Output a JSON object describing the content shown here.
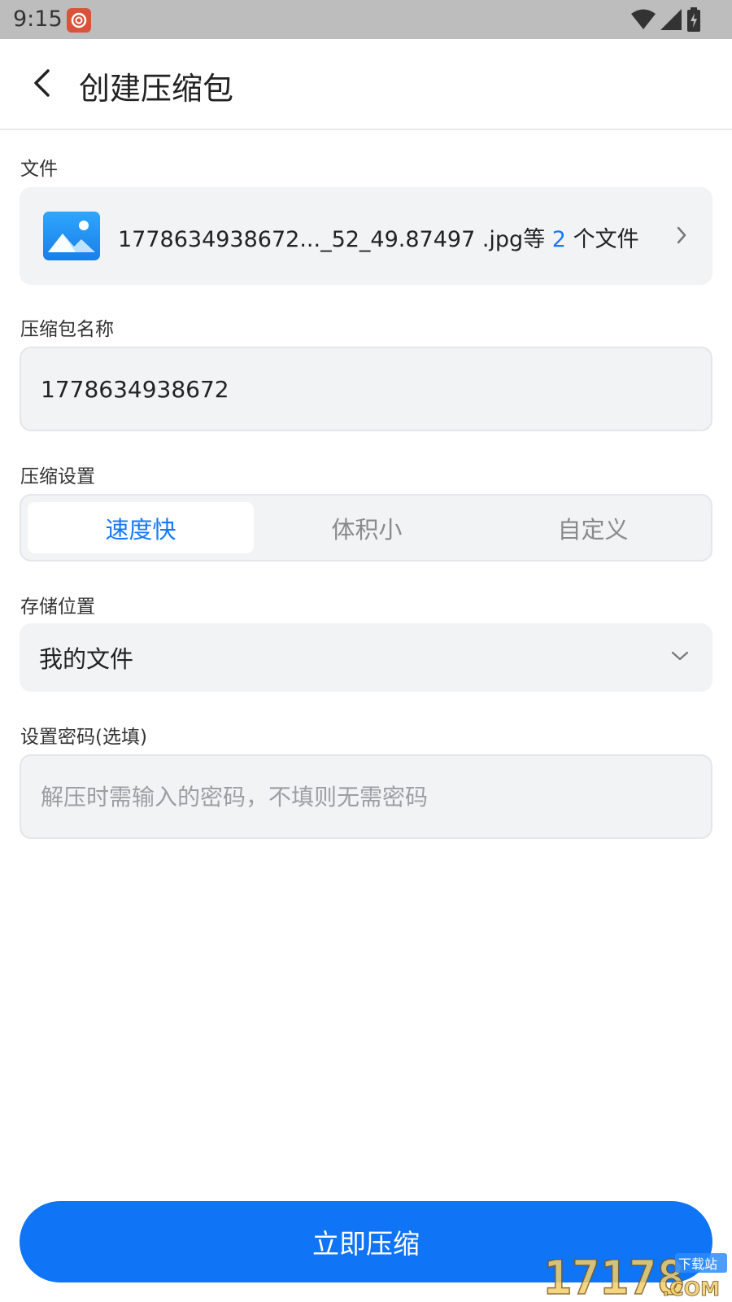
{
  "status_bar": {
    "time": "9:15"
  },
  "header": {
    "title": "创建压缩包"
  },
  "files": {
    "label": "文件",
    "name_text": "1778634938672..._52_49.87497 .jpg等",
    "count": "2",
    "suffix": "个文件"
  },
  "archive_name": {
    "label": "压缩包名称",
    "value": "1778634938672"
  },
  "compression": {
    "label": "压缩设置",
    "options": [
      "速度快",
      "体积小",
      "自定义"
    ],
    "selected_index": 0
  },
  "storage": {
    "label": "存储位置",
    "value": "我的文件"
  },
  "password": {
    "label": "设置密码(选填)",
    "placeholder": "解压时需输入的密码，不填则无需密码"
  },
  "action": {
    "compress_label": "立即压缩"
  },
  "colors": {
    "accent": "#1677ff",
    "button": "#0f74f6",
    "card": "#f2f3f5"
  },
  "watermark": {
    "text": "17178.COM 下载站"
  }
}
